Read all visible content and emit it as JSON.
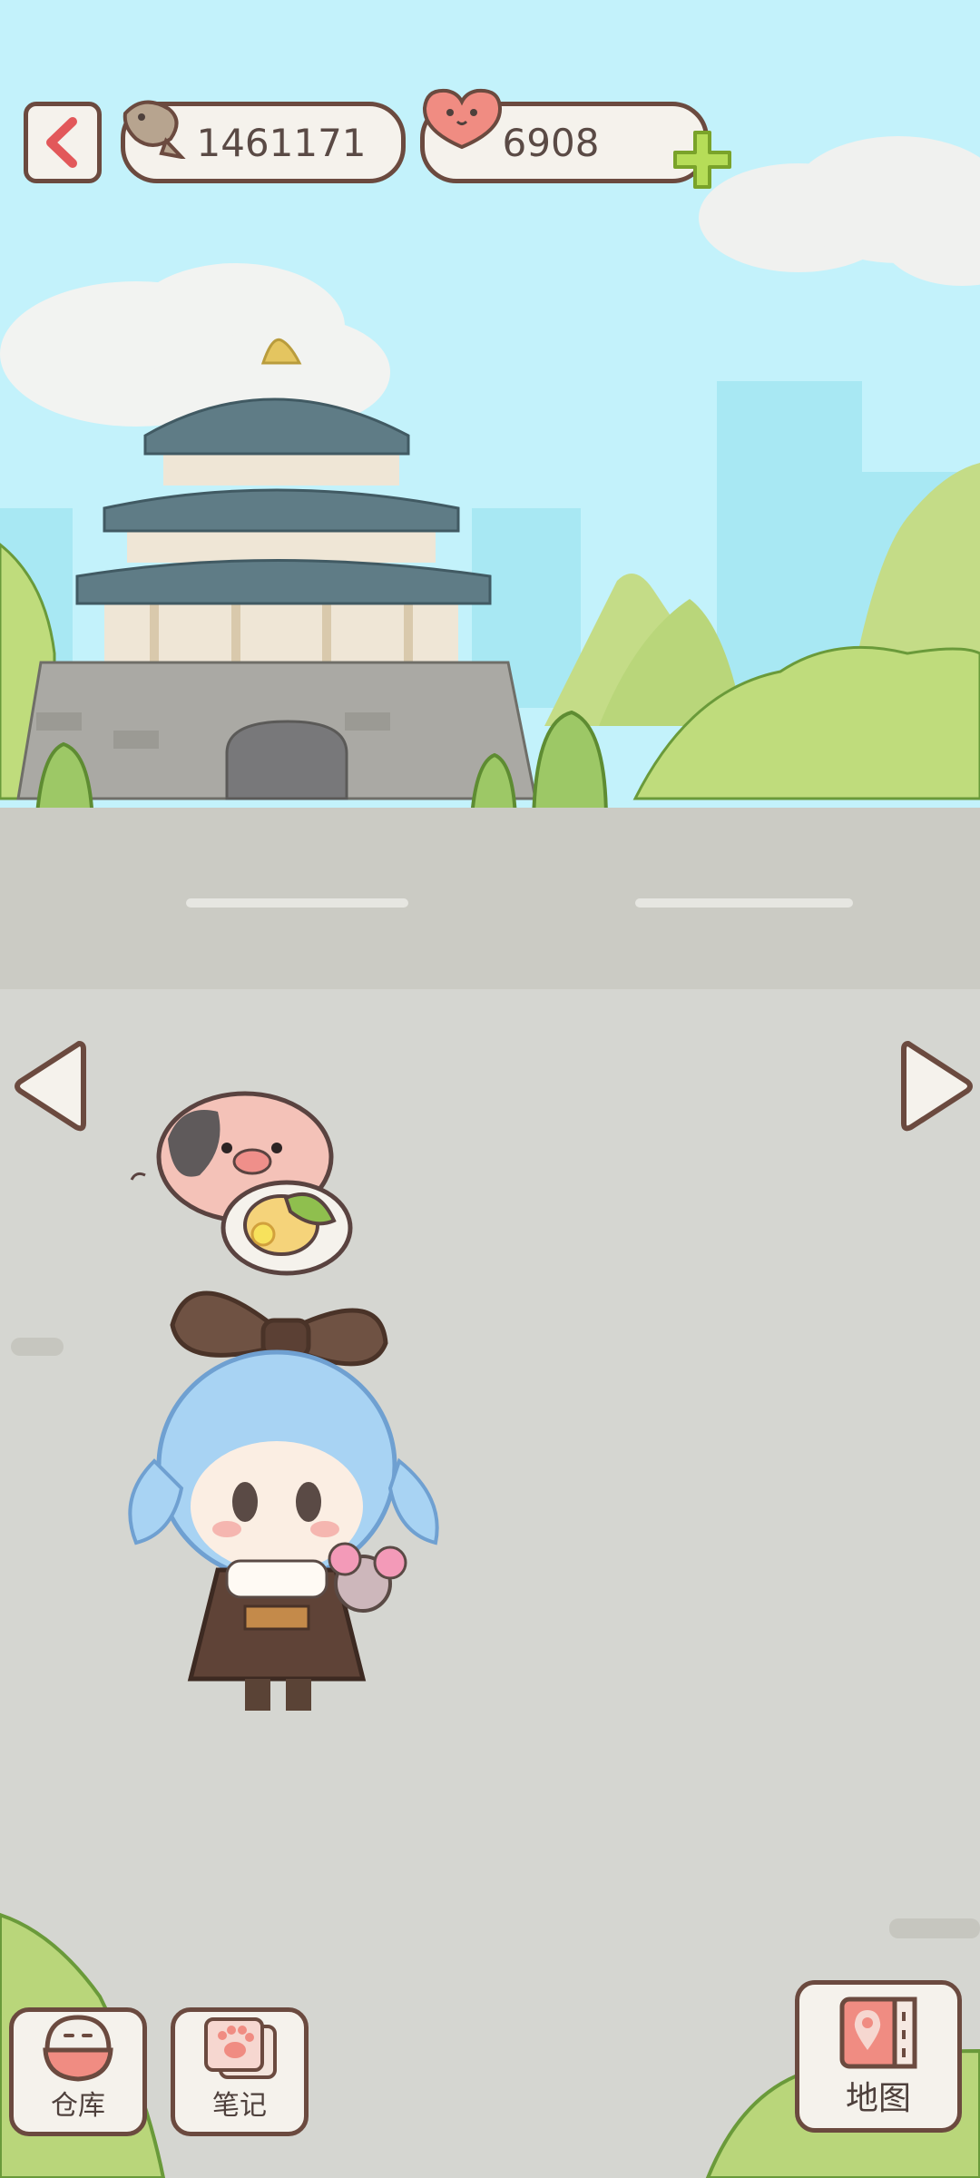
{
  "header": {
    "fish_count": "1461171",
    "heart_count": "6908"
  },
  "bottom_bar": {
    "storage_label": "仓库",
    "notes_label": "笔记",
    "map_label": "地图"
  },
  "icons": {
    "back": "chevron-left-icon",
    "fish": "fish-icon",
    "heart": "heart-icon",
    "add": "plus-icon",
    "prev": "triangle-left-icon",
    "next": "triangle-right-icon",
    "storage": "storage-bowl-icon",
    "notes": "paw-notebook-icon",
    "map": "map-book-icon"
  },
  "colors": {
    "sky": "#c3f2fb",
    "road": "#cbcbc4",
    "ground": "#d5d6d1",
    "outline": "#6b4a3f",
    "accent_green": "#b6dd58",
    "accent_red": "#e2585a"
  }
}
